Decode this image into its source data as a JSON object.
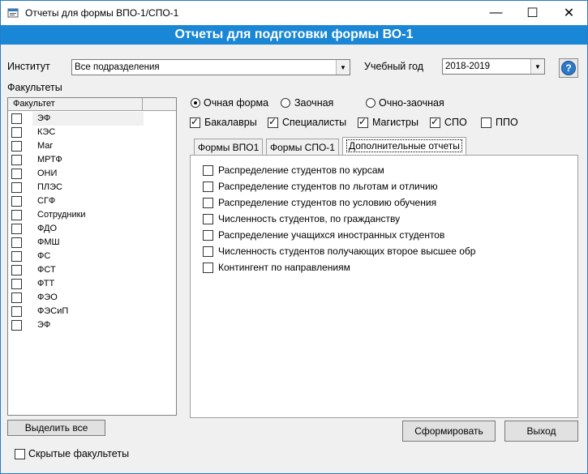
{
  "window": {
    "title": "Отчеты для формы ВПО-1/СПО-1",
    "minimize": "—",
    "maximize": "☐",
    "close": "✕"
  },
  "banner": "Отчеты для подготовки формы ВО-1",
  "institute": {
    "label": "Институт",
    "value": "Все подразделения"
  },
  "year": {
    "label": "Учебный год",
    "value": "2018-2019"
  },
  "help": {
    "label": "?"
  },
  "faculties": {
    "label": "Факультеты",
    "column_header": "Факультет",
    "items": [
      {
        "name": "ЭФ",
        "checked": false
      },
      {
        "name": "КЭС",
        "checked": false
      },
      {
        "name": "Маг",
        "checked": false
      },
      {
        "name": "МРТФ",
        "checked": false
      },
      {
        "name": "ОНИ",
        "checked": false
      },
      {
        "name": "ПЛЭС",
        "checked": false
      },
      {
        "name": "СГФ",
        "checked": false
      },
      {
        "name": "Сотрудники",
        "checked": false
      },
      {
        "name": "ФДО",
        "checked": false
      },
      {
        "name": "ФМШ",
        "checked": false
      },
      {
        "name": "ФС",
        "checked": false
      },
      {
        "name": "ФСТ",
        "checked": false
      },
      {
        "name": "ФТТ",
        "checked": false
      },
      {
        "name": "ФЭО",
        "checked": false
      },
      {
        "name": "ФЭСиП",
        "checked": false
      },
      {
        "name": "ЭФ",
        "checked": false
      }
    ],
    "select_all": "Выделить все",
    "hidden": "Скрытые факультеты"
  },
  "study_form": {
    "options": [
      "Очная форма",
      "Заочная",
      "Очно-заочная"
    ],
    "selected": "Очная форма"
  },
  "levels": [
    {
      "label": "Бакалавры",
      "checked": true
    },
    {
      "label": "Специалисты",
      "checked": true
    },
    {
      "label": "Магистры",
      "checked": true
    },
    {
      "label": "СПО",
      "checked": true
    },
    {
      "label": "ППО",
      "checked": false
    }
  ],
  "tabs": [
    {
      "label": "Формы ВПО1",
      "active": false
    },
    {
      "label": "Формы СПО-1",
      "active": false
    },
    {
      "label": "Дополнительные отчеты",
      "active": true
    }
  ],
  "reports": [
    "Распределение студентов по курсам",
    "Распределение студентов  по льготам и отличию",
    "Распределение студентов по условию обучения",
    "Численность студентов, по гражданству",
    "Распределение учащихся иностранных студентов",
    "Численность студентов получающих второе высшее обр",
    "Контингент по направлениям"
  ],
  "actions": {
    "generate": "Сформировать",
    "exit": "Выход"
  },
  "colors": {
    "banner": "#1a86d6",
    "window_border": "#2b7bc4"
  }
}
